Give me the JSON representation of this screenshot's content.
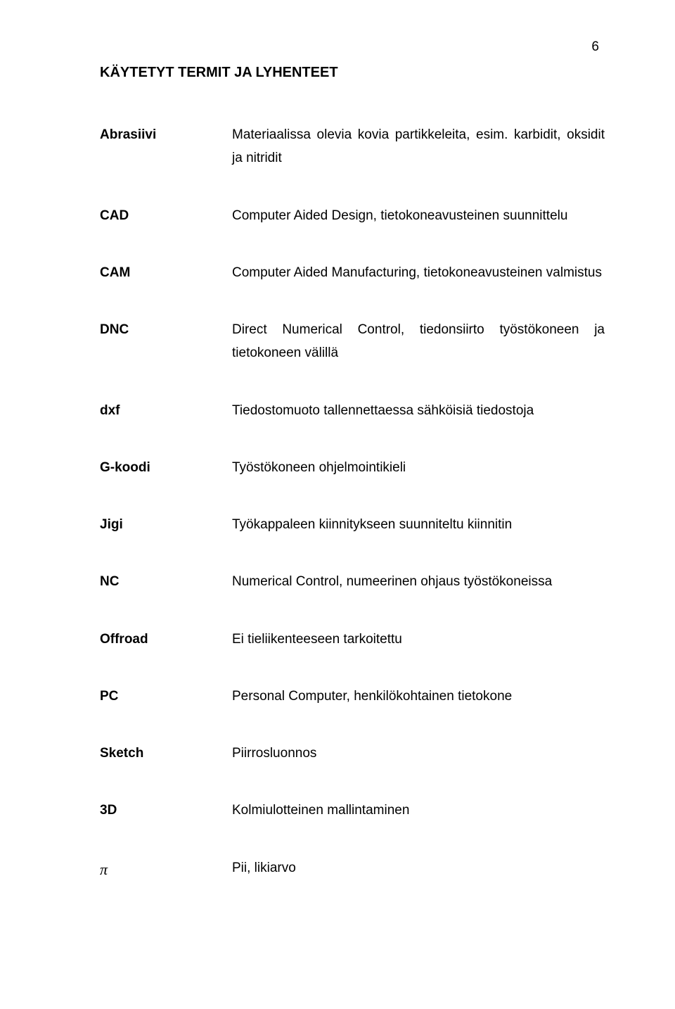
{
  "page_number": "6",
  "heading": "KÄYTETYT TERMIT JA LYHENTEET",
  "terms": {
    "abrasiivi": {
      "term": "Abrasiivi",
      "def": "Materiaalissa olevia kovia partikkeleita, esim. karbidit, oksidit ja nitridit"
    },
    "cad": {
      "term": "CAD",
      "def": "Computer Aided Design, tietokoneavusteinen suunnittelu"
    },
    "cam": {
      "term": "CAM",
      "def": "Computer Aided Manufacturing, tietokoneavusteinen valmistus"
    },
    "dnc": {
      "term": "DNC",
      "def": "Direct Numerical Control, tiedonsiirto työstökoneen ja tietokoneen välillä"
    },
    "dxf": {
      "term": "dxf",
      "def": "Tiedostomuoto tallennettaessa sähköisiä tiedostoja"
    },
    "gkoodi": {
      "term": "G-koodi",
      "def": "Työstökoneen ohjelmointikieli"
    },
    "jigi": {
      "term": "Jigi",
      "def": "Työkappaleen kiinnitykseen suunniteltu kiinnitin"
    },
    "nc": {
      "term": "NC",
      "def": "Numerical Control, numeerinen ohjaus työstökoneissa"
    },
    "offroad": {
      "term": "Offroad",
      "def": "Ei tieliikenteeseen tarkoitettu"
    },
    "pc": {
      "term": "PC",
      "def": "Personal Computer, henkilökohtainen tietokone"
    },
    "sketch": {
      "term": "Sketch",
      "def": "Piirrosluonnos"
    },
    "3d": {
      "term": "3D",
      "def": "Kolmiulotteinen mallintaminen"
    },
    "pi": {
      "term": "π",
      "def": "Pii, likiarvo"
    }
  }
}
